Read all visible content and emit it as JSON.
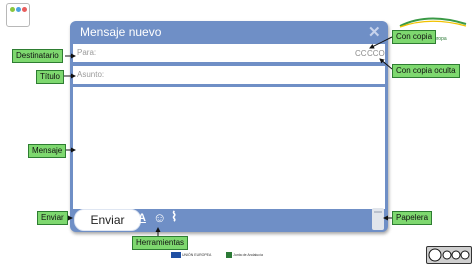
{
  "compose": {
    "title": "Mensaje nuevo",
    "to_placeholder": "Para:",
    "cc": "CC",
    "bcc": "CCO",
    "subject_placeholder": "Asunto:",
    "send_label": "Enviar",
    "format_glyph": "A",
    "emoji_glyph": "☺",
    "attach_glyph": "⌇",
    "close_glyph": "✕"
  },
  "labels": {
    "destinatario": "Destinatario",
    "titulo": "Título",
    "mensaje": "Mensaje",
    "enviar": "Enviar",
    "herramientas": "Herramientas",
    "con_copia": "Con copia",
    "con_copia_oculta": "Con copia oculta",
    "papelera": "Papelera"
  },
  "brand": {
    "andalucia_line1": "Andalucía",
    "andalucia_line2": "se mueve con Europa",
    "footer_eu": "UNIÓN EUROPEA",
    "footer_junta": "Junta de Andalucía"
  },
  "colors": {
    "window": "#6f8fc6",
    "label_bg": "#7ed86f"
  }
}
